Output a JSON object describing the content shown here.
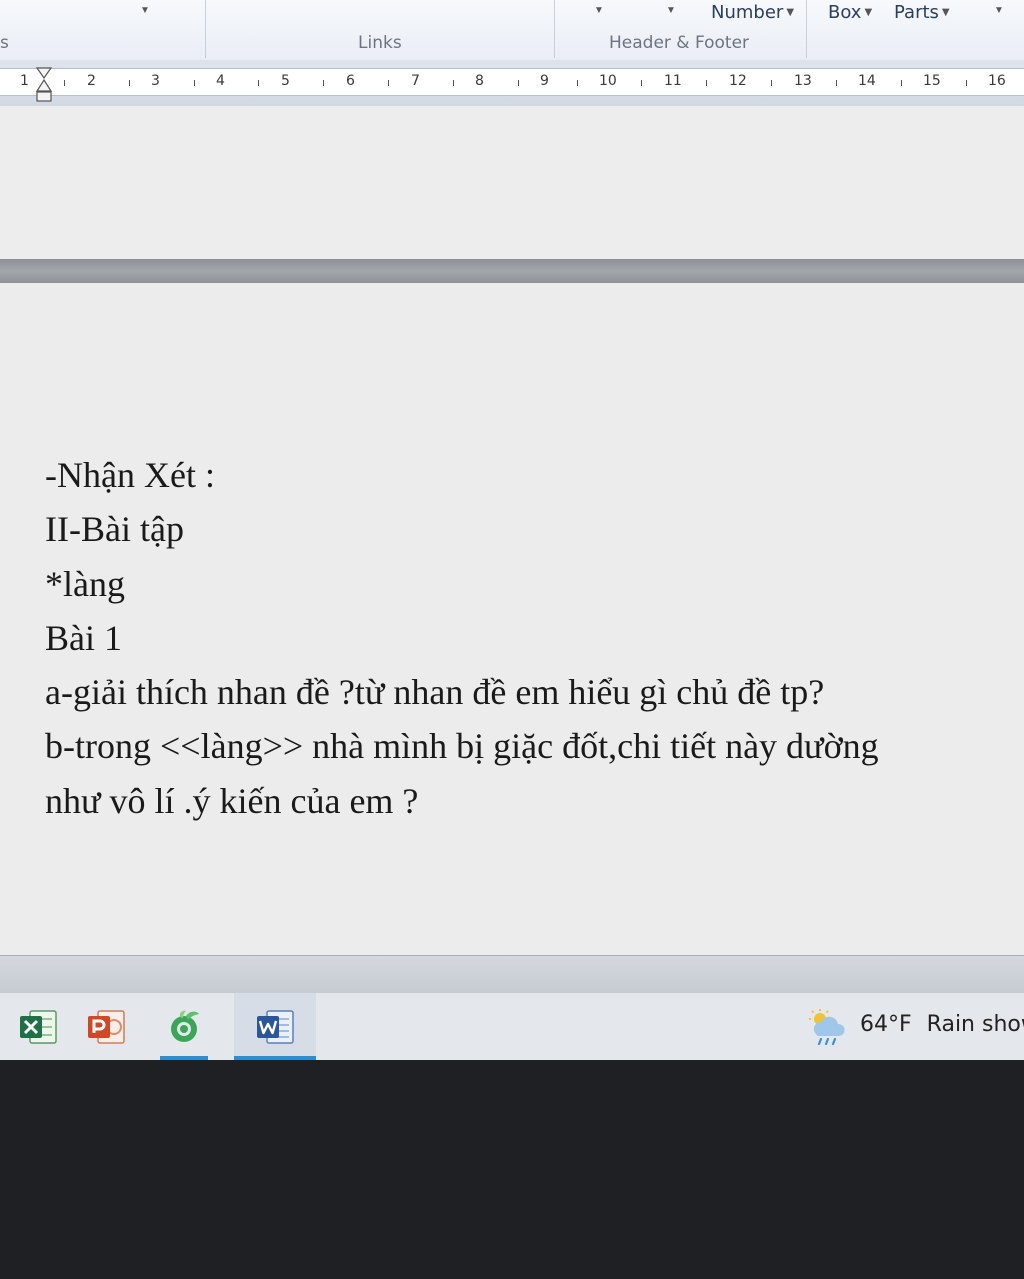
{
  "ribbon": {
    "left_group_label": "s",
    "links_group_label": "Links",
    "header_footer_group_label": "Header & Footer",
    "page_number_label": "Number",
    "text_box_label": "Box",
    "quick_parts_label": "Parts"
  },
  "ruler": {
    "ticks": [
      "1",
      "2",
      "3",
      "4",
      "5",
      "6",
      "7",
      "8",
      "9",
      "10",
      "11",
      "12",
      "13",
      "14",
      "15",
      "16"
    ]
  },
  "document": {
    "lines": [
      "-Nhận Xét :",
      "II-Bài tập",
      "*làng",
      "Bài 1",
      "a-giải thích nhan đề ?từ nhan đề em hiểu gì chủ đề tp?",
      "b-trong <<làng>> nhà mình bị giặc đốt,chi tiết này dường",
      "như vô lí .ý kiến của em ?"
    ]
  },
  "taskbar": {
    "apps": [
      {
        "name": "excel",
        "icon": "excel-icon",
        "accent": "#1e7145"
      },
      {
        "name": "powerpoint",
        "icon": "powerpoint-icon",
        "accent": "#d24726"
      },
      {
        "name": "coccoc",
        "icon": "coccoc-browser-icon",
        "accent": "#3aa757"
      },
      {
        "name": "word",
        "icon": "word-icon",
        "accent": "#2b579a"
      }
    ],
    "weather": {
      "icon": "rain-shower-icon",
      "temperature": "64°F",
      "condition": "Rain show"
    }
  }
}
